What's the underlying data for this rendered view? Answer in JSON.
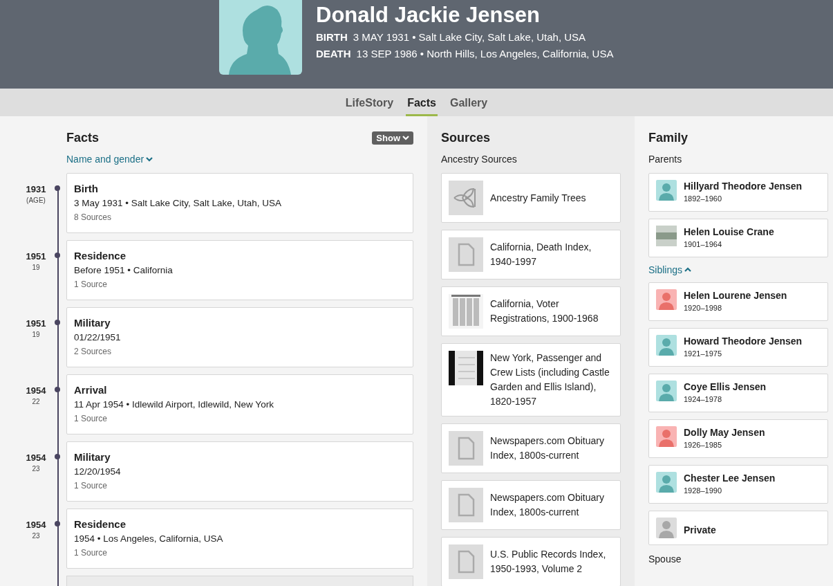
{
  "profile": {
    "name": "Donald Jackie Jensen",
    "events": [
      {
        "label": "BIRTH",
        "value": "3 MAY 1931 • Salt Lake City, Salt Lake, Utah, USA"
      },
      {
        "label": "DEATH",
        "value": "13 SEP 1986 • North Hills, Los Angeles, California, USA"
      }
    ]
  },
  "tabs": [
    {
      "label": "LifeStory",
      "selected": false
    },
    {
      "label": "Facts",
      "selected": true
    },
    {
      "label": "Gallery",
      "selected": false
    }
  ],
  "facts": {
    "title": "Facts",
    "show_button": "Show",
    "filter_link": "Name and gender",
    "items": [
      {
        "year": "1931",
        "age": "(AGE)",
        "title": "Birth",
        "detail": "3 May 1931 • Salt Lake City, Salt Lake, Utah, USA",
        "sources": "8 Sources"
      },
      {
        "year": "1951",
        "age": "19",
        "title": "Residence",
        "detail": "Before 1951 • California",
        "sources": "1 Source"
      },
      {
        "year": "1951",
        "age": "19",
        "title": "Military",
        "detail": "01/22/1951",
        "sources": "2 Sources"
      },
      {
        "year": "1954",
        "age": "22",
        "title": "Arrival",
        "detail": "11 Apr 1954 • Idlewild Airport, Idlewild, New York",
        "sources": "1 Source"
      },
      {
        "year": "1954",
        "age": "23",
        "title": "Military",
        "detail": "12/20/1954",
        "sources": "1 Source"
      },
      {
        "year": "1954",
        "age": "23",
        "title": "Residence",
        "detail": "1954 • Los Angeles, California, USA",
        "sources": "1 Source"
      }
    ]
  },
  "sources": {
    "title": "Sources",
    "subtitle": "Ancestry Sources",
    "items": [
      {
        "kind": "tree",
        "title": "Ancestry Family Trees"
      },
      {
        "kind": "document",
        "title": "California, Death Index, 1940-1997"
      },
      {
        "kind": "scan",
        "title": "California, Voter Registrations, 1900-1968"
      },
      {
        "kind": "film",
        "title": "New York, Passenger and Crew Lists (including Castle Garden and Ellis Island), 1820-1957"
      },
      {
        "kind": "document",
        "title": "Newspapers.com Obituary Index, 1800s-current"
      },
      {
        "kind": "document",
        "title": "Newspapers.com Obituary Index, 1800s-current"
      },
      {
        "kind": "document",
        "title": "U.S. Public Records Index, 1950-1993, Volume 2"
      }
    ]
  },
  "family": {
    "title": "Family",
    "parents_label": "Parents",
    "parents": [
      {
        "kind": "male",
        "name": "Hillyard Theodore Jensen",
        "years": "1892–1960"
      },
      {
        "kind": "photo",
        "name": "Helen Louise Crane",
        "years": "1901–1964"
      }
    ],
    "siblings_label": "Siblings",
    "siblings_expanded": true,
    "siblings": [
      {
        "kind": "female",
        "name": "Helen Lourene Jensen",
        "years": "1920–1998"
      },
      {
        "kind": "male",
        "name": "Howard Theodore Jensen",
        "years": "1921–1975"
      },
      {
        "kind": "male",
        "name": "Coye Ellis Jensen",
        "years": "1924–1978"
      },
      {
        "kind": "female",
        "name": "Dolly May Jensen",
        "years": "1926–1985"
      },
      {
        "kind": "male",
        "name": "Chester Lee Jensen",
        "years": "1928–1990"
      },
      {
        "kind": "private",
        "name": "Private"
      }
    ],
    "spouse_label": "Spouse"
  }
}
